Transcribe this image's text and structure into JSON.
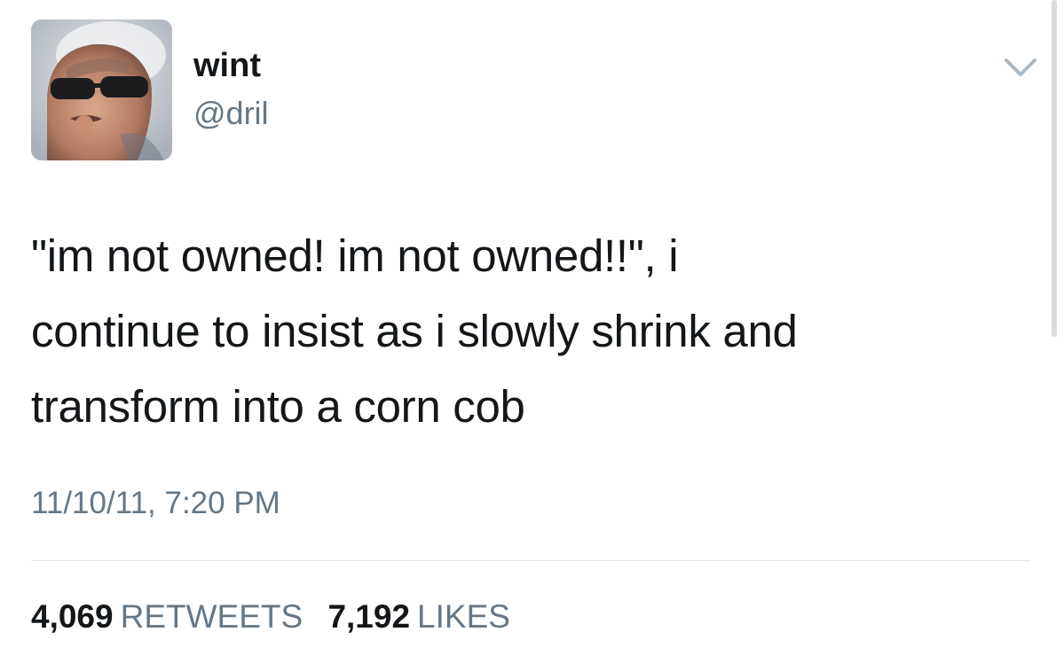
{
  "author": {
    "display_name": "wint",
    "handle": "@dril"
  },
  "tweet": {
    "line1": "\"im not owned!  im not owned!!\", i",
    "line2": "continue to insist as i slowly shrink and",
    "line3": "transform into a corn cob",
    "timestamp": "11/10/11, 7:20 PM"
  },
  "stats": {
    "retweets_count": "4,069",
    "retweets_label": "RETWEETS",
    "likes_count": "7,192",
    "likes_label": "LIKES"
  },
  "icons": {
    "menu": "chevron-down-icon"
  },
  "colors": {
    "text_primary": "#14171a",
    "text_secondary": "#657786",
    "divider": "#e1e8ed",
    "chevron": "#aab8c2"
  }
}
